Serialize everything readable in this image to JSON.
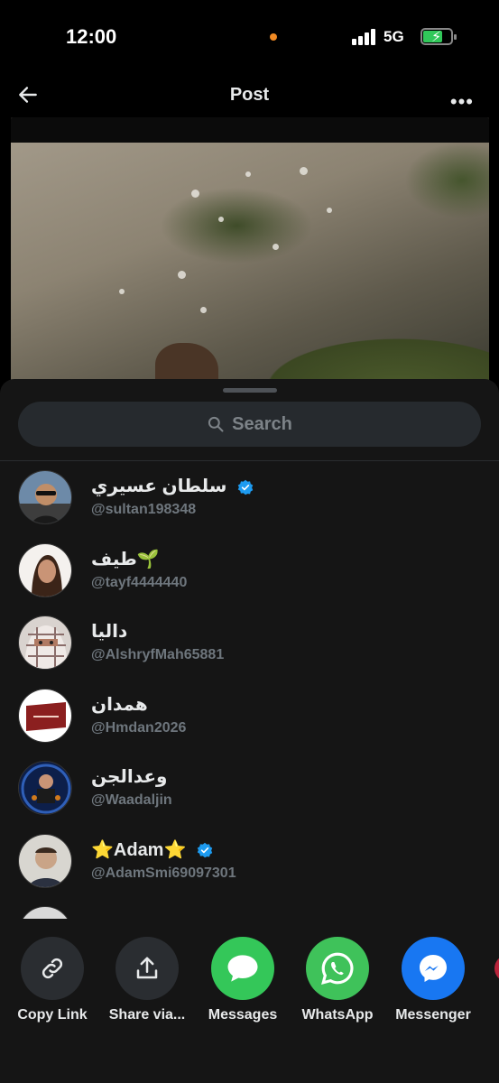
{
  "status_bar": {
    "time": "12:00",
    "network": "5G"
  },
  "header": {
    "title": "Post"
  },
  "share_sheet": {
    "search": {
      "label": "Search"
    },
    "contacts": [
      {
        "name": "سلطان عسيري",
        "handle": "@sultan198348",
        "verified": true
      },
      {
        "name": "طيف🌱",
        "handle": "@tayf4444440",
        "verified": false
      },
      {
        "name": "داليا",
        "handle": "@AlshryfMah65881",
        "verified": false
      },
      {
        "name": "همدان",
        "handle": "@Hmdan2026",
        "verified": false
      },
      {
        "name": "وعدالجن",
        "handle": "@Waadaljin",
        "verified": false
      },
      {
        "name": "⭐Adam⭐",
        "handle": "@AdamSmi69097301",
        "verified": true
      }
    ],
    "actions": [
      {
        "label": "Copy Link",
        "icon": "link-icon"
      },
      {
        "label": "Share via...",
        "icon": "share-upload-icon"
      },
      {
        "label": "Messages",
        "icon": "messages-icon",
        "color": "#34c759"
      },
      {
        "label": "WhatsApp",
        "icon": "whatsapp-icon",
        "color": "#3fc25a"
      },
      {
        "label": "Messenger",
        "icon": "messenger-icon",
        "color": "#1877f2"
      }
    ]
  },
  "colors": {
    "background": "#000000",
    "sheet": "#151515",
    "verified": "#1d9bf0",
    "muted_text": "#6e767d"
  }
}
